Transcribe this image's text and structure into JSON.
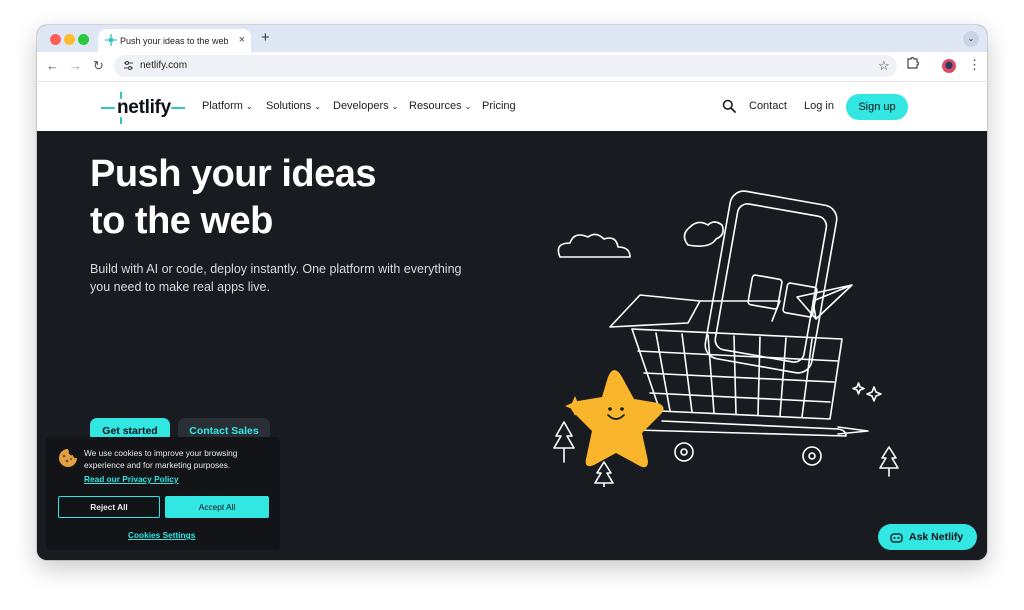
{
  "browser": {
    "tab_title": "Push your ideas to the web | Ne",
    "tab_close": "×",
    "new_tab": "+",
    "tab_menu": "⌄",
    "url": "netlify.com",
    "back": "←",
    "forward": "→",
    "reload": "↻",
    "bookmark": "☆",
    "menu": "⋮"
  },
  "header": {
    "logo": "netlify",
    "nav": [
      {
        "label": "Platform",
        "chevron": "⌄"
      },
      {
        "label": "Solutions",
        "chevron": "⌄"
      },
      {
        "label": "Developers",
        "chevron": "⌄"
      },
      {
        "label": "Resources",
        "chevron": "⌄"
      },
      {
        "label": "Pricing"
      }
    ],
    "contact": "Contact",
    "login": "Log in",
    "signup": "Sign up"
  },
  "hero": {
    "title_line1": "Push your ideas",
    "title_line2": "to the web",
    "subtitle": "Build with AI or code, deploy instantly. One platform with everything you need to make real apps live.",
    "primary_cta": "Get started",
    "secondary_cta": "Contact Sales"
  },
  "cookie": {
    "text": "We use cookies to improve your browsing experience and for marketing purposes.",
    "privacy_link": "Read our Privacy Policy",
    "reject": "Reject All",
    "accept": "Accept All",
    "settings": "Cookies Settings"
  },
  "assistant": {
    "label": "Ask Netlify"
  },
  "colors": {
    "accent": "#32e6e2",
    "hero_bg": "#181b20",
    "star": "#f9b52b"
  }
}
